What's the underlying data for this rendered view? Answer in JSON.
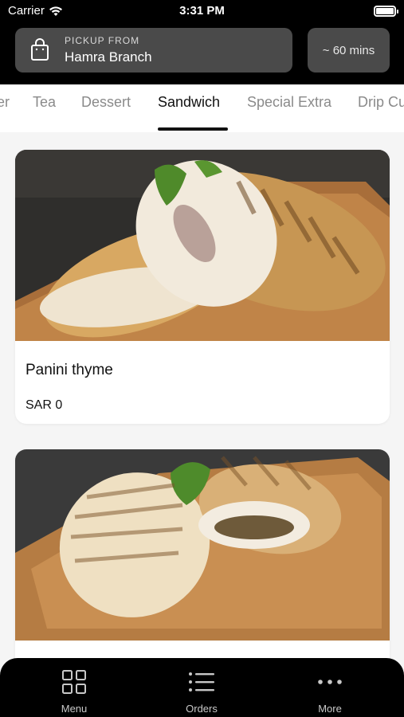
{
  "status": {
    "carrier": "Carrier",
    "time": "3:31 PM"
  },
  "header": {
    "pickup_label": "PICKUP FROM",
    "branch": "Hamra Branch",
    "eta": "~ 60 mins"
  },
  "tabs": [
    {
      "label": "er"
    },
    {
      "label": "Tea"
    },
    {
      "label": "Dessert"
    },
    {
      "label": "Sandwich",
      "active": true
    },
    {
      "label": "Special Extra"
    },
    {
      "label": "Drip Cu"
    }
  ],
  "products": [
    {
      "name": "Panini thyme",
      "price": "SAR 0"
    },
    {
      "name": "",
      "price": ""
    }
  ],
  "nav": [
    {
      "label": "Menu",
      "icon": "grid-icon"
    },
    {
      "label": "Orders",
      "icon": "list-icon"
    },
    {
      "label": "More",
      "icon": "more-icon"
    }
  ],
  "colors": {
    "header_bg": "#000000",
    "chip_bg": "#4a4a4a",
    "page_bg": "#f5f5f5",
    "active_tab": "#111111",
    "inactive_tab": "#8a8a8a"
  }
}
